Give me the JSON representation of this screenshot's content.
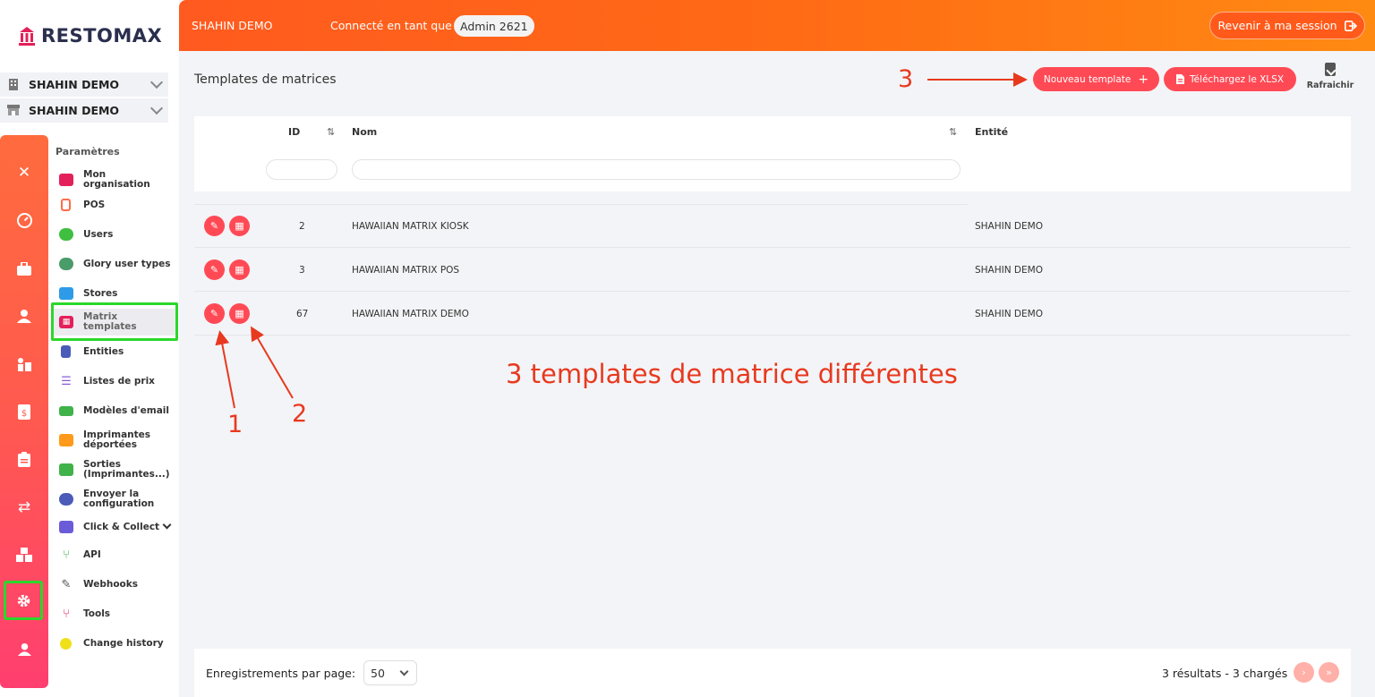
{
  "brand": {
    "logo_text": "RESTOMAX"
  },
  "org_selectors": [
    {
      "label": "SHAHIN DEMO",
      "icon": "building-icon"
    },
    {
      "label": "SHAHIN DEMO",
      "icon": "store-icon"
    }
  ],
  "rail": {
    "items": [
      "close-icon",
      "dashboard-icon",
      "briefcase-icon",
      "user-icon",
      "staff-icon",
      "invoice-icon",
      "clipboard-icon",
      "transfer-icon",
      "boxes-icon",
      "gear-icon",
      "profile-icon"
    ],
    "selected": "gear-icon"
  },
  "menu": {
    "header": "Paramètres",
    "items": [
      {
        "label": "Mon organisation",
        "color": "#e4205a"
      },
      {
        "label": "POS",
        "color": "#ff6b4a"
      },
      {
        "label": "Users",
        "color": "#3fbf3f"
      },
      {
        "label": "Glory user types",
        "color": "#4a9c6a"
      },
      {
        "label": "Stores",
        "color": "#2d9be8"
      },
      {
        "label": "Matrix templates",
        "color": "#e4205a"
      },
      {
        "label": "Entities",
        "color": "#4a5cb8"
      },
      {
        "label": "Listes de prix",
        "color": "#8a5cd8"
      },
      {
        "label": "Modèles d'email",
        "color": "#3fb24a"
      },
      {
        "label": "Imprimantes déportées",
        "color": "#ff9a1a"
      },
      {
        "label": "Sorties (Imprimantes...)",
        "color": "#3fb24a"
      },
      {
        "label": "Envoyer la configuration",
        "color": "#4a5cb8"
      },
      {
        "label": "Click & Collect",
        "color": "#6a5cd8"
      },
      {
        "label": "API",
        "color": "#3fb24a"
      },
      {
        "label": "Webhooks",
        "color": "#555555"
      },
      {
        "label": "Tools",
        "color": "#e4205a"
      },
      {
        "label": "Change history",
        "color": "#f0e01a"
      }
    ],
    "active": "Matrix templates"
  },
  "topbar": {
    "org": "SHAHIN DEMO",
    "connected_as": "Connecté en tant que",
    "user": "Admin 2621",
    "return_label": "Revenir à ma session"
  },
  "page": {
    "title": "Templates de matrices",
    "new_button": "Nouveau template",
    "xlsx_button": "Téléchargez le XLSX",
    "refresh_label": "Rafraichir"
  },
  "table": {
    "headers": {
      "id": "ID",
      "name": "Nom",
      "entity": "Entité"
    },
    "rows": [
      {
        "id": "2",
        "name": "HAWAIIAN MATRIX KIOSK",
        "entity": "SHAHIN DEMO"
      },
      {
        "id": "3",
        "name": "HAWAIIAN MATRIX POS",
        "entity": "SHAHIN DEMO"
      },
      {
        "id": "67",
        "name": "HAWAIIAN MATRIX DEMO",
        "entity": "SHAHIN DEMO"
      }
    ]
  },
  "annotations": {
    "n1": "1",
    "n2": "2",
    "n3": "3",
    "note": "3 templates de matrice différentes",
    "color": "#e8391f"
  },
  "footer": {
    "per_page_label": "Enregistrements par page:",
    "per_page_value": "50",
    "results": "3 résultats - 3 chargés"
  },
  "colors": {
    "accent": "#ff4a55",
    "topbar_start": "#ff5a1f",
    "topbar_end": "#ff8a12",
    "highlight": "#2ad82a"
  }
}
